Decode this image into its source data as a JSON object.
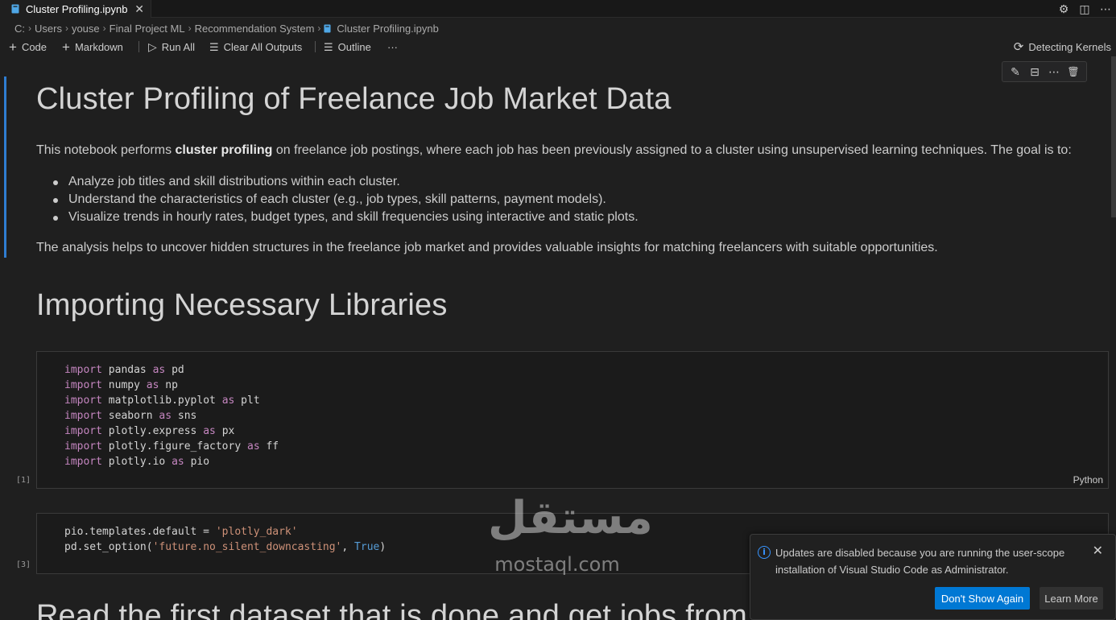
{
  "tab": {
    "title": "Cluster Profiling.ipynb",
    "close_glyph": "✕"
  },
  "tab_actions": [
    {
      "name": "settings-gear-icon",
      "glyph": "⚙"
    },
    {
      "name": "split-editor-icon",
      "glyph": "◫"
    },
    {
      "name": "more-actions-icon",
      "glyph": "⋯"
    }
  ],
  "breadcrumb": {
    "items": [
      "C:",
      "Users",
      "youse",
      "Final Project ML",
      "Recommendation System"
    ],
    "file": "Cluster Profiling.ipynb",
    "separator": "›"
  },
  "toolbar": {
    "code_label": "Code",
    "markdown_label": "Markdown",
    "run_all_label": "Run All",
    "clear_outputs_label": "Clear All Outputs",
    "outline_label": "Outline",
    "more_glyph": "···",
    "add_glyph": "+",
    "run_glyph": "▷",
    "clear_glyph": "☰",
    "outline_glyph": "☰"
  },
  "kernel": {
    "label": "Detecting Kernels",
    "glyph": "⟳"
  },
  "cell_toolbar": {
    "edit_glyph": "✎",
    "split_glyph": "⊟",
    "more_glyph": "⋯",
    "delete_glyph": "🗑"
  },
  "markdown": {
    "title": "Cluster Profiling of Freelance Job Market Data",
    "intro_before": "This notebook performs ",
    "intro_bold": "cluster profiling",
    "intro_after": " on freelance job postings, where each job has been previously assigned to a cluster using unsupervised learning techniques. The goal is to:",
    "bullets": [
      "Analyze job titles and skill distributions within each cluster.",
      "Understand the characteristics of each cluster (e.g., job types, skill patterns, payment models).",
      "Visualize trends in hourly rates, budget types, and skill frequencies using interactive and static plots."
    ],
    "summary": "The analysis helps to uncover hidden structures in the freelance job market and provides valuable insights for matching freelancers with suitable opportunities.",
    "heading2": "Importing Necessary Libraries",
    "heading3": "Read the first dataset that is done and get jobs from doing c"
  },
  "code_cells": [
    {
      "exec_count": "[1]",
      "language": "Python",
      "lines": [
        {
          "kw": "import",
          "mod": "pandas",
          "alias": "pd"
        },
        {
          "kw": "import",
          "mod": "numpy",
          "alias": "np"
        },
        {
          "kw": "import",
          "mod": "matplotlib.pyplot",
          "alias": "plt"
        },
        {
          "kw": "import",
          "mod": "seaborn",
          "alias": "sns"
        },
        {
          "kw": "import",
          "mod": "plotly.express",
          "alias": "px"
        },
        {
          "kw": "import",
          "mod": "plotly.figure_factory",
          "alias": "ff"
        },
        {
          "kw": "import",
          "mod": "plotly.io",
          "alias": "pio"
        }
      ],
      "as_kw": "as"
    },
    {
      "exec_count": "[3]",
      "line1_prefix": "pio.templates.default = ",
      "line1_str": "'plotly_dark'",
      "line2_prefix": "pd.set_option(",
      "line2_str": "'future.no_silent_downcasting'",
      "line2_sep": ", ",
      "line2_const": "True",
      "line2_suffix": ")"
    }
  ],
  "watermark": {
    "logo": "مستقل",
    "url": "mostaql.com"
  },
  "notification": {
    "message": "Updates are disabled because you are running the user-scope installation of Visual Studio Code as Administrator.",
    "info_glyph": "i",
    "close_glyph": "✕",
    "primary_button": "Don't Show Again",
    "secondary_button": "Learn More"
  },
  "colors": {
    "accent": "#0078d4",
    "focus_bar": "#2f7dd1",
    "keyword": "#c586c0",
    "string": "#ce9178",
    "constant": "#569cd6"
  }
}
